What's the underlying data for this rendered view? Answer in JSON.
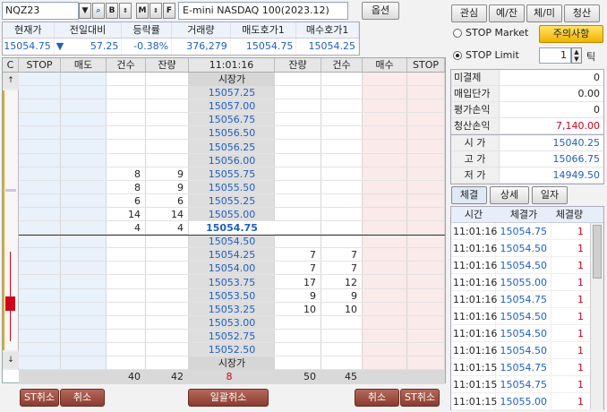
{
  "symbol": {
    "code": "NQZ23",
    "name": "E-mini NASDAQ 100(2023.12)",
    "option_label": "옵션"
  },
  "quote": {
    "headers": [
      "현재가",
      "전일대비",
      "등락률",
      "거래량",
      "매도호가1",
      "매수호가1"
    ],
    "values": [
      "15054.75",
      "57.25",
      "-0.38%",
      "376,279",
      "15054.75",
      "15054.25"
    ],
    "down_arrow": "▼"
  },
  "right_buttons": [
    "관심",
    "예/잔",
    "체/미",
    "청산"
  ],
  "stop": {
    "market_label": "STOP Market",
    "limit_label": "STOP Limit",
    "notice_label": "주의사항",
    "tick_value": "1",
    "tick_label": "틱"
  },
  "account": [
    {
      "label": "미결제",
      "value": "0"
    },
    {
      "label": "매입단가",
      "value": "0.00"
    },
    {
      "label": "평가손익",
      "value": "0"
    },
    {
      "label": "청산손익",
      "value": "7,140.00"
    }
  ],
  "ohl": [
    {
      "label": "시 가",
      "value": "15040.25"
    },
    {
      "label": "고 가",
      "value": "15066.75"
    },
    {
      "label": "저 가",
      "value": "14949.50"
    }
  ],
  "trade_tabs": [
    "체결",
    "상세",
    "일자"
  ],
  "trade_headers": [
    "시간",
    "체결가",
    "체결량"
  ],
  "trades": [
    [
      "11:01:16",
      "15054.75",
      "1"
    ],
    [
      "11:01:16",
      "15054.50",
      "1"
    ],
    [
      "11:01:16",
      "15054.50",
      "1"
    ],
    [
      "11:01:16",
      "15055.00",
      "1"
    ],
    [
      "11:01:16",
      "15054.75",
      "1"
    ],
    [
      "11:01:16",
      "15054.50",
      "1"
    ],
    [
      "11:01:16",
      "15054.50",
      "1"
    ],
    [
      "11:01:16",
      "15054.50",
      "1"
    ],
    [
      "11:01:15",
      "15054.75",
      "1"
    ],
    [
      "11:01:15",
      "15054.75",
      "1"
    ],
    [
      "11:01:15",
      "15055.00",
      "1"
    ]
  ],
  "ladder": {
    "headers": [
      "C",
      "STOP",
      "매도",
      "건수",
      "잔량",
      "11:01:16",
      "잔량",
      "건수",
      "매수",
      "STOP"
    ],
    "market_label": "시장가",
    "rows": [
      {
        "price": "15057.25",
        "sc": "",
        "sq": "",
        "bq": "",
        "bc": ""
      },
      {
        "price": "15057.00",
        "sc": "",
        "sq": "",
        "bq": "",
        "bc": ""
      },
      {
        "price": "15056.75",
        "sc": "",
        "sq": "",
        "bq": "",
        "bc": ""
      },
      {
        "price": "15056.50",
        "sc": "",
        "sq": "",
        "bq": "",
        "bc": ""
      },
      {
        "price": "15056.25",
        "sc": "",
        "sq": "",
        "bq": "",
        "bc": ""
      },
      {
        "price": "15056.00",
        "sc": "",
        "sq": "",
        "bq": "",
        "bc": ""
      },
      {
        "price": "15055.75",
        "sc": "8",
        "sq": "9",
        "bq": "",
        "bc": ""
      },
      {
        "price": "15055.50",
        "sc": "8",
        "sq": "9",
        "bq": "",
        "bc": ""
      },
      {
        "price": "15055.25",
        "sc": "6",
        "sq": "6",
        "bq": "",
        "bc": ""
      },
      {
        "price": "15055.00",
        "sc": "14",
        "sq": "14",
        "bq": "",
        "bc": ""
      },
      {
        "price": "15054.75",
        "sc": "4",
        "sq": "4",
        "bq": "",
        "bc": ""
      },
      {
        "price": "15054.50",
        "sc": "",
        "sq": "",
        "bq": "",
        "bc": ""
      },
      {
        "price": "15054.25",
        "sc": "",
        "sq": "",
        "bq": "7",
        "bc": "7"
      },
      {
        "price": "15054.00",
        "sc": "",
        "sq": "",
        "bq": "7",
        "bc": "7"
      },
      {
        "price": "15053.75",
        "sc": "",
        "sq": "",
        "bq": "17",
        "bc": "12"
      },
      {
        "price": "15053.50",
        "sc": "",
        "sq": "",
        "bq": "9",
        "bc": "9"
      },
      {
        "price": "15053.25",
        "sc": "",
        "sq": "",
        "bq": "10",
        "bc": "10"
      },
      {
        "price": "15053.00",
        "sc": "",
        "sq": "",
        "bq": "",
        "bc": ""
      },
      {
        "price": "15052.75",
        "sc": "",
        "sq": "",
        "bq": "",
        "bc": ""
      },
      {
        "price": "15052.50",
        "sc": "",
        "sq": "",
        "bq": "",
        "bc": ""
      }
    ],
    "totals": {
      "sell_count": "40",
      "sell_qty": "42",
      "diff": "8",
      "buy_qty": "50",
      "buy_count": "45"
    }
  },
  "bottom_buttons": {
    "st_cancel_left": "ST취소",
    "cancel_left": "취소",
    "cancel_all": "일괄취소",
    "cancel_right": "취소",
    "st_cancel_right": "ST취소"
  }
}
